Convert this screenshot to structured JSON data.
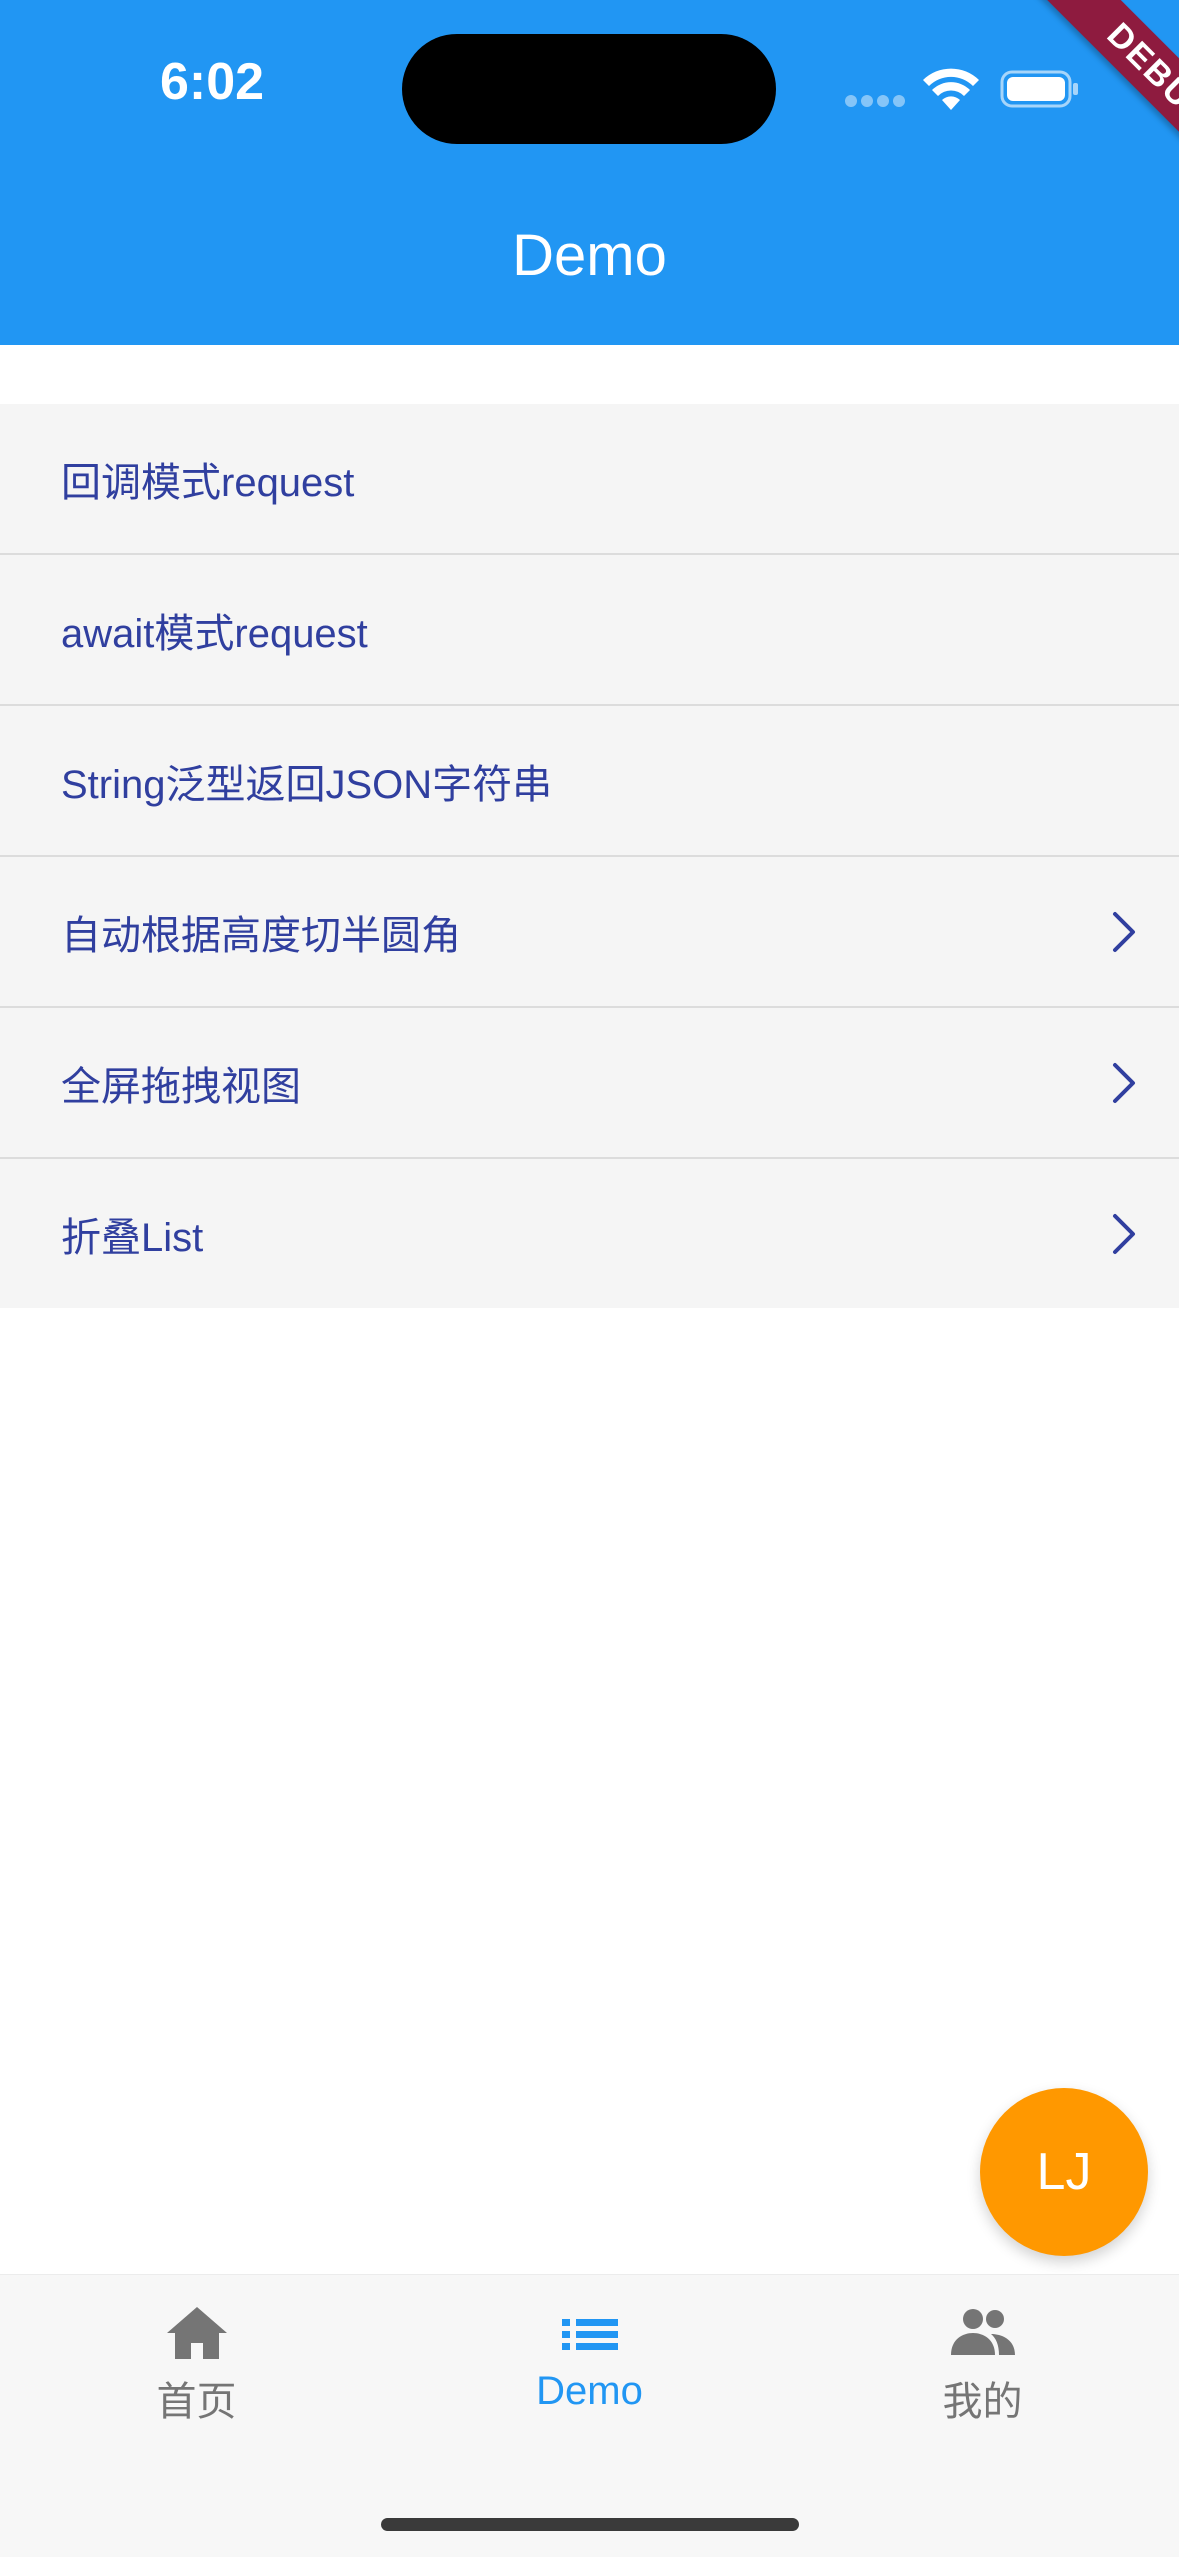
{
  "status_bar": {
    "time": "6:02"
  },
  "debug_banner": "DEBUG",
  "app_bar": {
    "title": "Demo",
    "color": "#2196F3"
  },
  "list": {
    "items": [
      {
        "label": "回调模式request",
        "has_chevron": false
      },
      {
        "label": "await模式request",
        "has_chevron": false
      },
      {
        "label": "String泛型返回JSON字符串",
        "has_chevron": false
      },
      {
        "label": "自动根据高度切半圆角",
        "has_chevron": true
      },
      {
        "label": "全屏拖拽视图",
        "has_chevron": true
      },
      {
        "label": "折叠List",
        "has_chevron": true
      }
    ],
    "text_color": "#303F9F"
  },
  "fab": {
    "label": "LJ",
    "color": "#FF9800"
  },
  "bottom_nav": {
    "items": [
      {
        "label": "首页",
        "icon": "home-icon",
        "active": false
      },
      {
        "label": "Demo",
        "icon": "list-icon",
        "active": true
      },
      {
        "label": "我的",
        "icon": "people-icon",
        "active": false
      }
    ],
    "active_color": "#2196F3",
    "inactive_color": "#757575"
  }
}
